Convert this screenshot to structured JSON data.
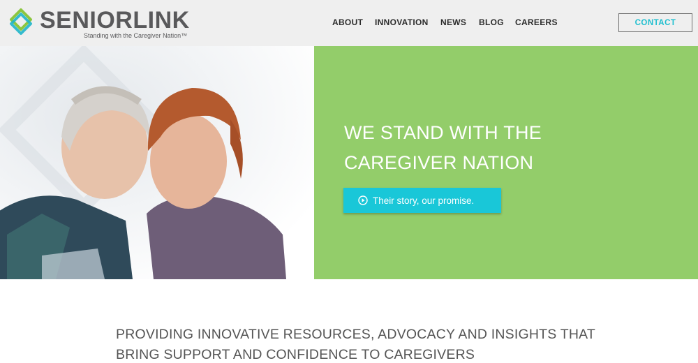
{
  "header": {
    "logo": {
      "wordmark": "SENIORLINK",
      "tagline": "Standing with the Caregiver Nation™"
    },
    "nav": [
      {
        "label": "ABOUT"
      },
      {
        "label": "INNOVATION"
      },
      {
        "label": "NEWS"
      },
      {
        "label": "BLOG"
      },
      {
        "label": "CAREERS"
      }
    ],
    "contact_label": "CONTACT"
  },
  "hero": {
    "title_line1": "WE STAND WITH THE",
    "title_line2": "CAREGIVER NATION",
    "cta_label": "Their story, our promise.",
    "cta_icon": "play-circle-icon"
  },
  "intro": {
    "line1": "PROVIDING INNOVATIVE RESOURCES, ADVOCACY AND INSIGHTS THAT",
    "line2": "BRING SUPPORT AND CONFIDENCE TO CAREGIVERS"
  },
  "colors": {
    "header_bg": "#efefef",
    "hero_green": "#93cd6a",
    "accent_teal": "#19c7d8",
    "logo_green": "#8cc63f",
    "logo_teal": "#1fb5c9",
    "text_gray": "#555555"
  }
}
